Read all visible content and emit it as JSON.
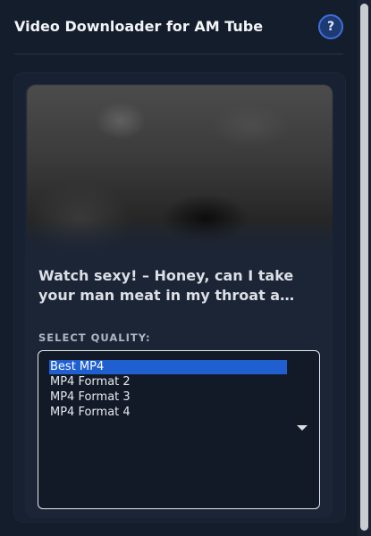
{
  "header": {
    "title": "Video Downloader for AM Tube",
    "help_label": "?"
  },
  "video": {
    "title": "Watch sexy! – Honey, can I take your man meat in my throat a…"
  },
  "quality": {
    "label": "SELECT QUALITY:",
    "options": [
      "Best MP4",
      "MP4 Format 2",
      "MP4 Format 3",
      "MP4 Format 4"
    ],
    "selected": "Best MP4"
  },
  "colors": {
    "background": "#141d2c",
    "accent": "#1f5fd0",
    "help_button": "#1e3a72"
  }
}
